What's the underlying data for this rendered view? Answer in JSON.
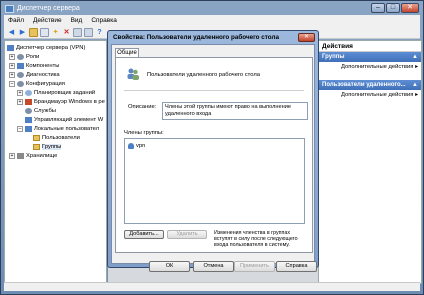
{
  "window": {
    "title": "Диспетчер сервера",
    "controls": [
      "–",
      "□",
      "✕"
    ]
  },
  "menu": [
    "Файл",
    "Действие",
    "Вид",
    "Справка"
  ],
  "tree": [
    {
      "label": "Диспетчер сервера (VPN)",
      "level": 0,
      "expander": "",
      "icon": "server-icon"
    },
    {
      "label": "Роли",
      "level": 1,
      "expander": "+",
      "icon": "roles-icon"
    },
    {
      "label": "Компоненты",
      "level": 1,
      "expander": "+",
      "icon": "features-icon"
    },
    {
      "label": "Диагностика",
      "level": 1,
      "expander": "+",
      "icon": "diagnostics-icon"
    },
    {
      "label": "Конфигурация",
      "level": 1,
      "expander": "–",
      "icon": "configuration-icon"
    },
    {
      "label": "Планировщик заданий",
      "level": 2,
      "expander": "+",
      "icon": "scheduler-icon"
    },
    {
      "label": "Брандмауэр Windows в ре",
      "level": 2,
      "expander": "+",
      "icon": "firewall-icon"
    },
    {
      "label": "Службы",
      "level": 2,
      "expander": "",
      "icon": "services-icon"
    },
    {
      "label": "Управляющий элемент W",
      "level": 2,
      "expander": "",
      "icon": "wmi-icon"
    },
    {
      "label": "Локальные пользовател",
      "level": 2,
      "expander": "–",
      "icon": "local-users-icon"
    },
    {
      "label": "Пользователи",
      "level": 3,
      "expander": "",
      "icon": "folder-icon"
    },
    {
      "label": "Группы",
      "level": 3,
      "expander": "",
      "icon": "folder-icon"
    },
    {
      "label": "Хранилище",
      "level": 1,
      "expander": "+",
      "icon": "storage-icon"
    }
  ],
  "actions": {
    "header": "Действия",
    "groups": [
      {
        "title": "Группы",
        "link": "Дополнительные действия"
      },
      {
        "title": "Пользователи удаленного...",
        "link": "Дополнительные действия"
      }
    ]
  },
  "dialog": {
    "title": "Свойства: Пользователи удаленного рабочего стола",
    "close": "✕",
    "tab": "Общие",
    "group_name": "Пользователи удаленного рабочего стола",
    "description_label": "Описание:",
    "description": "Члены этой группы имеют право на выполнение удаленного входа",
    "members_label": "Члены группы:",
    "members": [
      "vpn"
    ],
    "add_button": "Добавить...",
    "remove_button": "Удалить",
    "note": "Изменения членства в группах вступят в силу после следующего входа пользователя в систему.",
    "buttons": {
      "ok": "ОК",
      "cancel": "Отмена",
      "apply": "Применить",
      "help": "Справка"
    }
  }
}
